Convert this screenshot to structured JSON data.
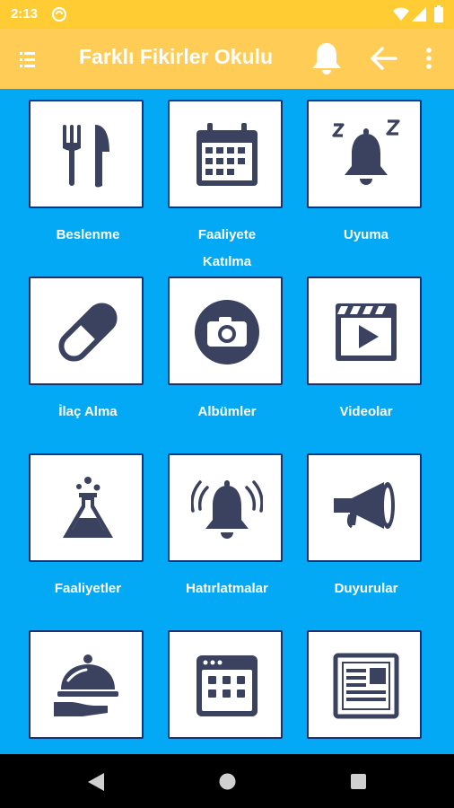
{
  "status_bar": {
    "time": "2:13",
    "icons": [
      "sync-icon",
      "wifi-icon",
      "signal-icon",
      "battery-icon"
    ]
  },
  "app_bar": {
    "title": "Farklı Fikirler Okulu",
    "icons": [
      "menu-icon",
      "bell-icon",
      "back-arrow-icon",
      "more-vert-icon"
    ]
  },
  "menu": {
    "items": [
      {
        "label": "Beslenme",
        "icon": "fork-knife-icon"
      },
      {
        "label": "Faaliyete Katılma",
        "icon": "calendar-icon"
      },
      {
        "label": "Uyuma",
        "icon": "sleep-bell-icon"
      },
      {
        "label": "İlaç Alma",
        "icon": "pill-icon"
      },
      {
        "label": "Albümler",
        "icon": "camera-icon"
      },
      {
        "label": "Videolar",
        "icon": "video-icon"
      },
      {
        "label": "Faaliyetler",
        "icon": "flask-icon"
      },
      {
        "label": "Hatırlatmalar",
        "icon": "ringing-bell-icon"
      },
      {
        "label": "Duyurular",
        "icon": "megaphone-icon"
      },
      {
        "label": "",
        "icon": "cloche-icon"
      },
      {
        "label": "",
        "icon": "calendar-grid-icon"
      },
      {
        "label": "",
        "icon": "newspaper-icon"
      }
    ]
  },
  "nav_bar": {
    "icons": [
      "back-triangle-icon",
      "home-circle-icon",
      "recents-square-icon"
    ]
  },
  "colors": {
    "status_bar": "#FFCC33",
    "app_bar": "#FFCC55",
    "background": "#03A9F4",
    "icon": "#3A4260",
    "tile_border": "#12357a"
  }
}
